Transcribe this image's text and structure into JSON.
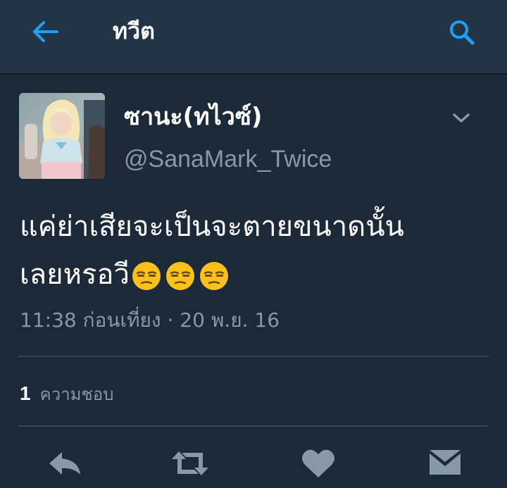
{
  "header": {
    "title": "ทวีต",
    "back_icon": "arrow-left-icon",
    "search_icon": "search-icon",
    "accent_color": "#1da1f2"
  },
  "tweet": {
    "display_name": "ซานะ(ทไวซ์)",
    "handle": "@SanaMark_Twice",
    "text_lines": [
      "แค่ย่าเสียจะเป็นจะตายขนาดนั้น",
      "เลยหรอวี"
    ],
    "emoji": "unamused-face",
    "emoji_count": 3,
    "timestamp": "11:38 ก่อนเที่ยง · 20 พ.ย. 16"
  },
  "stats": {
    "likes_count": "1",
    "likes_label": "ความชอบ"
  },
  "actions": [
    "reply-icon",
    "retweet-icon",
    "heart-icon",
    "direct-message-icon"
  ],
  "colors": {
    "background": "#1c2938",
    "app_bar": "#243447",
    "secondary_text": "#8899a6",
    "divider": "#38444d"
  }
}
